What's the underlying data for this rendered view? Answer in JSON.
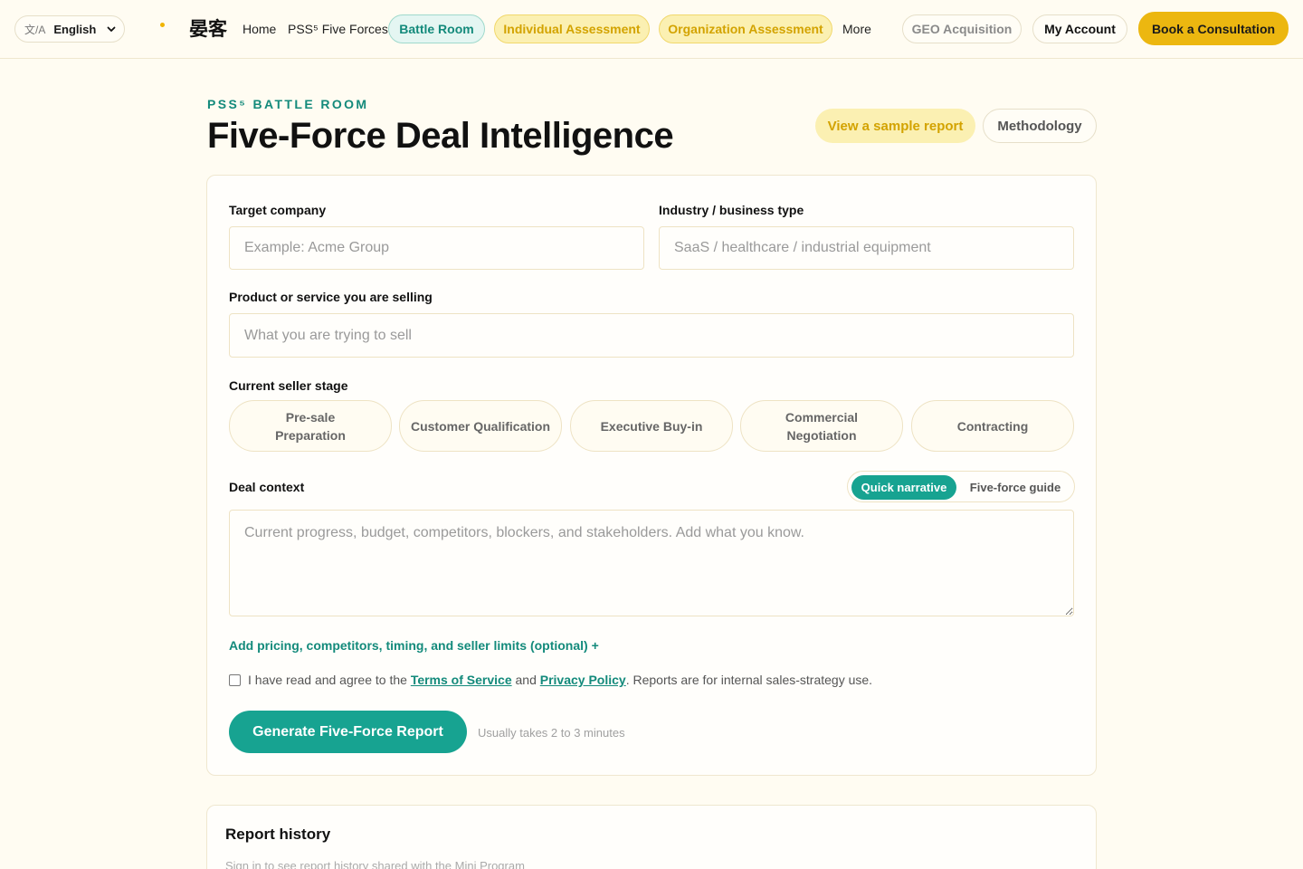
{
  "nav": {
    "lang_glyph": "文/A",
    "lang_label": "English",
    "brand": "晏客",
    "home": "Home",
    "five_forces": "PSS⁵ Five Forces",
    "battle_room": "Battle Room",
    "individual": "Individual Assessment",
    "organization": "Organization Assessment",
    "more": "More",
    "geo": "GEO Acquisition",
    "account": "My Account",
    "consult": "Book a Consultation"
  },
  "header": {
    "eyebrow": "PSS⁵ BATTLE ROOM",
    "title": "Five-Force Deal Intelligence",
    "sample": "View a sample report",
    "methodology": "Methodology"
  },
  "form": {
    "target_label": "Target company",
    "target_placeholder": "Example: Acme Group",
    "industry_label": "Industry / business type",
    "industry_placeholder": "SaaS / healthcare / industrial equipment",
    "product_label": "Product or service you are selling",
    "product_placeholder": "What you are trying to sell",
    "stage_label": "Current seller stage",
    "stages": [
      "Pre-sale Preparation",
      "Customer Qualification",
      "Executive Buy-in",
      "Commercial Negotiation",
      "Contracting"
    ],
    "context_label": "Deal context",
    "toggle_on": "Quick narrative",
    "toggle_off": "Five-force guide",
    "context_placeholder": "Current progress, budget, competitors, blockers, and stakeholders. Add what you know.",
    "optional": "Add pricing, competitors, timing, and seller limits (optional)  +",
    "agree_pre": "I have read and agree to the ",
    "terms": "Terms of Service",
    "agree_and": " and ",
    "privacy": "Privacy Policy",
    "agree_post": ". Reports are for internal sales-strategy use.",
    "generate": "Generate Five-Force Report",
    "hint": "Usually takes 2 to 3 minutes"
  },
  "history": {
    "title": "Report history",
    "subtitle": "Sign in to see report history shared with the Mini Program"
  },
  "colors": {
    "teal": "#17a391",
    "yellow": "#ecb710",
    "background": "#fffcf2"
  }
}
